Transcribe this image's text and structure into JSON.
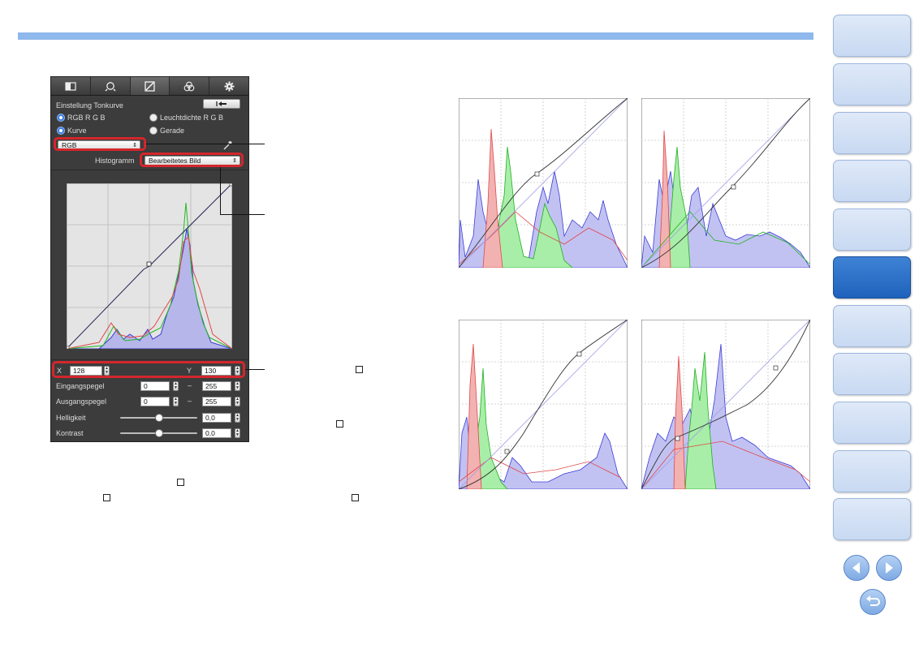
{
  "panel": {
    "tabs": [
      "basic-adjust-icon",
      "detail-icon",
      "tone-curve-icon",
      "color-icon",
      "settings-icon"
    ],
    "title": "Einstellung Tonkurve",
    "radio_rgb": "RGB R G B",
    "radio_luminance": "Leuchtdichte R G B",
    "radio_curve": "Kurve",
    "radio_line": "Gerade",
    "channel": "RGB",
    "histogram_label": "Histogramm",
    "histogram_value": "Bearbeitetes Bild",
    "x_label": "X",
    "x_value": "128",
    "y_label": "Y",
    "y_value": "130",
    "input_label": "Eingangspegel",
    "input_min": "0",
    "input_max": "255",
    "dash": "–",
    "output_label": "Ausgangspegel",
    "output_min": "0",
    "output_max": "255",
    "brightness_label": "Helligkeit",
    "brightness_value": "0,0",
    "brightness_level": 0.5,
    "contrast_label": "Kontrast",
    "contrast_value": "0,0",
    "contrast_level": 0.5
  },
  "colors": {
    "accent": "#1e62bc",
    "highlight": "#d4262c",
    "topbar": "#8fb8ec"
  },
  "nav": {
    "buttons": 11,
    "active_index": 5,
    "prev_icon": "arrow-left-icon",
    "next_icon": "arrow-right-icon",
    "back_icon": "return-icon"
  }
}
